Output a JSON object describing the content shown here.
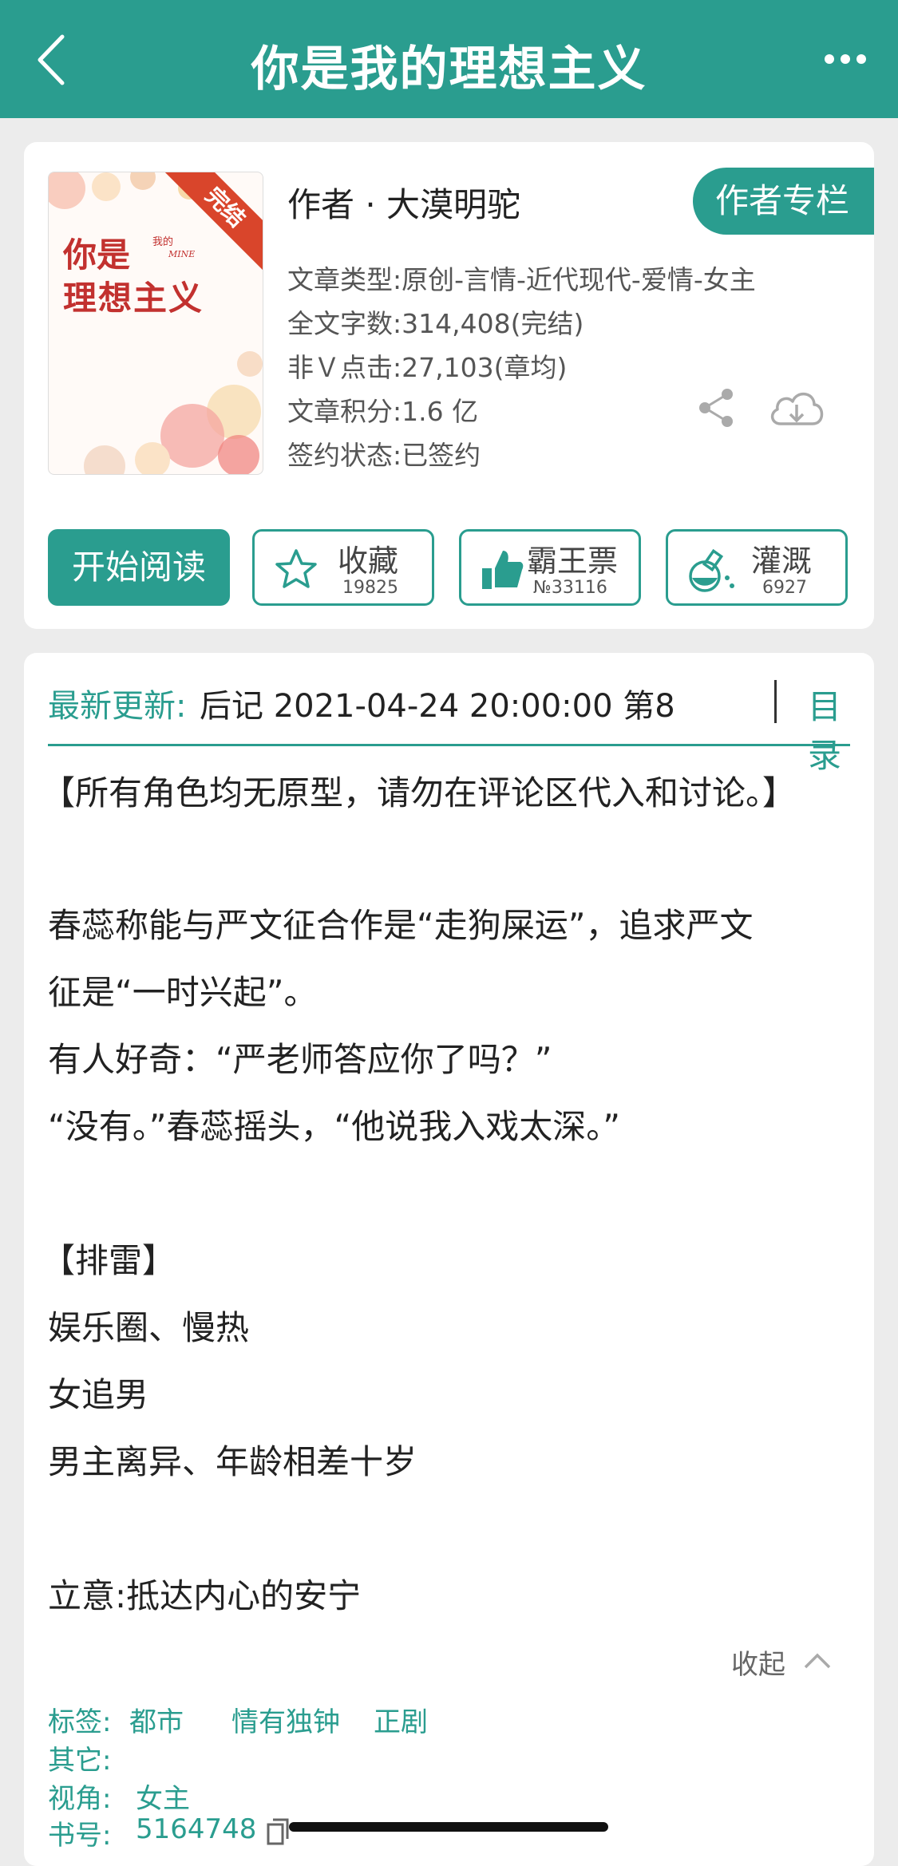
{
  "header": {
    "title": "你是我的理想主义",
    "back_icon": "chevron-left-icon",
    "more_icon": "more-dots-icon"
  },
  "book": {
    "cover": {
      "title_line1": "你是",
      "title_line2": "理想主义",
      "small_text": "我的",
      "mine_text": "MINE",
      "ribbon": "完结"
    },
    "author_line": "作者 · 大漠明驼",
    "author_column_button": "作者专栏",
    "meta": [
      "文章类型:原创-言情-近代现代-爱情-女主",
      "全文字数:314,408(完结)",
      "非Ｖ点击:27,103(章均)",
      "文章积分:1.6 亿",
      "签约状态:已签约"
    ]
  },
  "actions": {
    "start_reading": "开始阅读",
    "buttons": [
      {
        "label": "收藏",
        "count": "19825",
        "icon": "star-icon"
      },
      {
        "label": "霸王票",
        "count": "№33116",
        "icon": "thumbs-up-icon"
      },
      {
        "label": "灌溉",
        "count": "6927",
        "icon": "watering-flask-icon"
      }
    ]
  },
  "update": {
    "label": "最新更新:",
    "text": "后记 2021-04-24 20:00:00  第8",
    "toc": "目录"
  },
  "description": [
    "【所有角色均无原型，请勿在评论区代入和讨论。】",
    "",
    "春蕊称能与严文征合作是“走狗屎运”，追求严文",
    "征是“一时兴起”。",
    "有人好奇：“严老师答应你了吗？”",
    "“没有。”春蕊摇头，“他说我入戏太深。”",
    "",
    "【排雷】",
    "娱乐圈、慢热",
    "女追男",
    "男主离异、年龄相差十岁",
    "",
    "立意:抵达内心的安宁"
  ],
  "collapse_label": "收起",
  "tags": {
    "tags_label": "标签:",
    "tag_values": [
      "都市",
      "情有独钟",
      "正剧"
    ],
    "other_label": "其它:",
    "view_label": "视角:",
    "view_value": "女主",
    "book_no_label": "书号:",
    "book_no_value": "5164748"
  },
  "colors": {
    "accent": "#2a9d8f",
    "ribbon": "#d9452b",
    "cover_title": "#c2312f"
  }
}
